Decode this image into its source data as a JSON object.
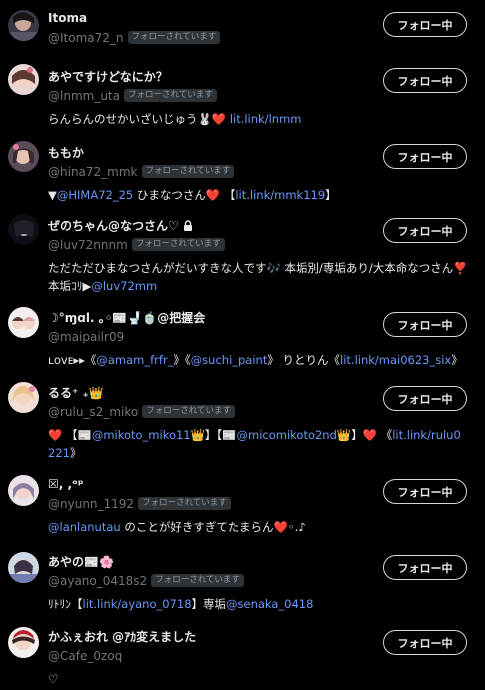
{
  "button_label": "フォロー中",
  "follows_you_label": "フォローされています",
  "users": [
    {
      "name": "Itoma",
      "handle": "@Itoma72_n",
      "follows_you": true,
      "bio": []
    },
    {
      "name": "あやですけどなにか？",
      "handle": "@lnmm_uta",
      "follows_you": true,
      "bio": [
        {
          "t": "text",
          "v": "らんらんのせかいざいじゅう"
        },
        {
          "t": "emoji",
          "v": "🐰"
        },
        {
          "t": "emoji",
          "v": "❤️"
        },
        {
          "t": "text",
          "v": " "
        },
        {
          "t": "link",
          "v": "lit.link/lnmm"
        }
      ]
    },
    {
      "name": "ももか",
      "handle": "@hina72_mmk",
      "follows_you": true,
      "bio": [
        {
          "t": "text",
          "v": "▼"
        },
        {
          "t": "link",
          "v": "@HIMA72_25"
        },
        {
          "t": "text",
          "v": " ひまなつさん"
        },
        {
          "t": "emoji",
          "v": "❤️"
        },
        {
          "t": "text",
          "v": " 【"
        },
        {
          "t": "link",
          "v": "lit.link/mmk119"
        },
        {
          "t": "text",
          "v": "】"
        }
      ]
    },
    {
      "name": "ぜのちゃん@なつさん♡",
      "locked": true,
      "handle": "@luv72nnnm",
      "follows_you": true,
      "bio": [
        {
          "t": "text",
          "v": "ただただひまなつさんがだいすきな人です"
        },
        {
          "t": "emoji",
          "v": "🎶"
        },
        {
          "t": "text",
          "v": " 本垢別/専垢あり/大本命なつさん"
        },
        {
          "t": "emoji",
          "v": "❣️"
        },
        {
          "t": "text",
          "v": " 本垢ｺﾘ▶"
        },
        {
          "t": "link",
          "v": "@luv72mm"
        }
      ]
    },
    {
      "name": "☽°ɱɑl. ｡◦📰🚽🍵@把握会",
      "handle": "@maipailr09",
      "follows_you": false,
      "bio": [
        {
          "t": "text",
          "v": "ʟᴏᴠᴇ▸▸《"
        },
        {
          "t": "link",
          "v": "@amam_frfr_"
        },
        {
          "t": "text",
          "v": "》《"
        },
        {
          "t": "link",
          "v": "@suchi_paint"
        },
        {
          "t": "text",
          "v": "》 りとりん《"
        },
        {
          "t": "link",
          "v": "lit.link/mai0623_six"
        },
        {
          "t": "text",
          "v": "》"
        }
      ]
    },
    {
      "name": "るる⁺ ₊👑",
      "handle": "@rulu_s2_miko",
      "follows_you": true,
      "bio": [
        {
          "t": "emoji",
          "v": "❤️"
        },
        {
          "t": "text",
          "v": " 【📰"
        },
        {
          "t": "link",
          "v": "@mikoto_miko11"
        },
        {
          "t": "text",
          "v": "👑】【📰"
        },
        {
          "t": "link",
          "v": "@micomikoto2nd"
        },
        {
          "t": "text",
          "v": "👑】"
        },
        {
          "t": "emoji",
          "v": "❤️"
        },
        {
          "t": "text",
          "v": " 《"
        },
        {
          "t": "link",
          "v": "lit.link/rulu0221"
        },
        {
          "t": "text",
          "v": "》"
        }
      ]
    },
    {
      "name": "☒, ,ᵒᵖ",
      "handle": "@nyunn_1192",
      "follows_you": true,
      "bio": [
        {
          "t": "link",
          "v": "@lanlanutau"
        },
        {
          "t": "text",
          "v": " のことが好きすぎてたまらん"
        },
        {
          "t": "emoji",
          "v": "❤️"
        },
        {
          "t": "text",
          "v": "◦.♪"
        }
      ]
    },
    {
      "name": "あやの📰🌸",
      "handle": "@ayano_0418s2",
      "follows_you": true,
      "bio": [
        {
          "t": "text",
          "v": "ﾘﾄﾘﾝ【"
        },
        {
          "t": "link",
          "v": "lit.link/ayano_0718"
        },
        {
          "t": "text",
          "v": "】専垢"
        },
        {
          "t": "link",
          "v": "@senaka_0418"
        }
      ]
    },
    {
      "name": "かふぇおれ @ｱｶ変えました",
      "handle": "@Cafe_0zoq",
      "follows_you": true,
      "bio": [
        {
          "t": "text",
          "v": "♡"
        }
      ]
    }
  ]
}
